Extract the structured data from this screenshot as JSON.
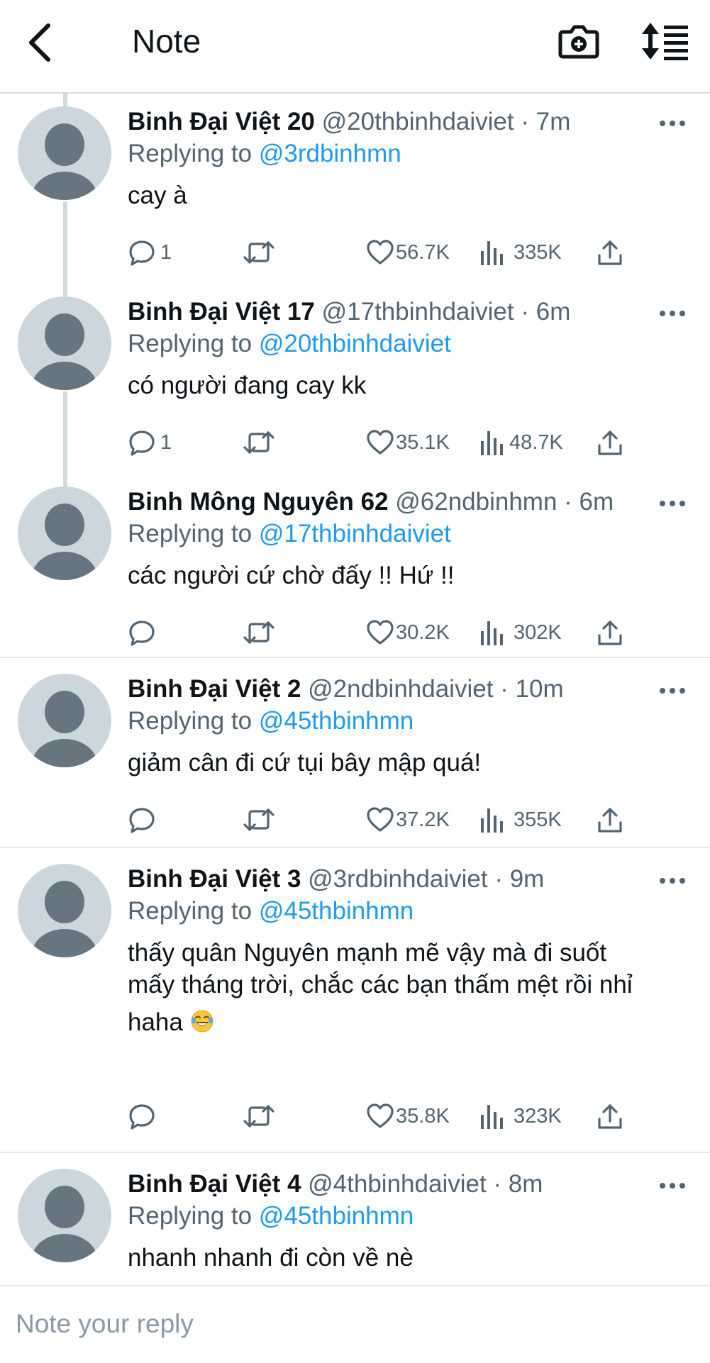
{
  "header": {
    "title": "Note",
    "icons": [
      "back-arrow-icon",
      "camera-add-icon",
      "sort-list-icon"
    ]
  },
  "colors": {
    "accent": "#1d9bf0",
    "secondary_text": "#536471",
    "avatar_bg": "#ccd6dd",
    "avatar_fg": "#66757f"
  },
  "tweets": [
    {
      "name": "Binh Đại Việt 20",
      "handle": "@20thbinhdaiviet · 7m",
      "replying_prefix": "Replying to ",
      "replying_to": "@3rdbinhmn",
      "text": "cay à",
      "replies": "1",
      "retweets": "",
      "likes": "56.7K",
      "views": "335K"
    },
    {
      "name": "Binh Đại Việt 17",
      "handle": "@17thbinhdaiviet · 6m",
      "replying_prefix": "Replying to ",
      "replying_to": "@20thbinhdaiviet",
      "text": "có người đang cay kk",
      "replies": "1",
      "retweets": "",
      "likes": "35.1K",
      "views": "48.7K"
    },
    {
      "name": "Binh Mông Nguyên 62",
      "handle": "@62ndbinhmn · 6m",
      "replying_prefix": "Replying to ",
      "replying_to": "@17thbinhdaiviet",
      "text": "các người cứ chờ đấy !! Hứ !!",
      "replies": "",
      "retweets": "",
      "likes": "30.2K",
      "views": "302K"
    },
    {
      "name": "Binh Đại Việt 2",
      "handle": "@2ndbinhdaiviet · 10m",
      "replying_prefix": "Replying to ",
      "replying_to": "@45thbinhmn",
      "text": "giảm cân đi cứ tụi bây mập quá!",
      "replies": "",
      "retweets": "",
      "likes": "37.2K",
      "views": "355K"
    },
    {
      "name": "Binh Đại Việt 3",
      "handle": "@3rdbinhdaiviet · 9m",
      "replying_prefix": "Replying to ",
      "replying_to": "@45thbinhmn",
      "text_line1": "thấy quân Nguyên mạnh mẽ vậy mà đi suốt",
      "text_line2": "mấy tháng trời, chắc các bạn thấm mệt rồi nhỉ",
      "text_line3": "haha",
      "emoji": "laughing-tears-emoji",
      "replies": "",
      "retweets": "",
      "likes": "35.8K",
      "views": "323K"
    },
    {
      "name": "Binh Đại Việt 4",
      "handle": "@4thbinhdaiviet · 8m",
      "replying_prefix": "Replying to ",
      "replying_to": "@45thbinhmn",
      "text": "nhanh nhanh đi còn về nè"
    }
  ],
  "composer": {
    "placeholder": "Note your reply"
  }
}
